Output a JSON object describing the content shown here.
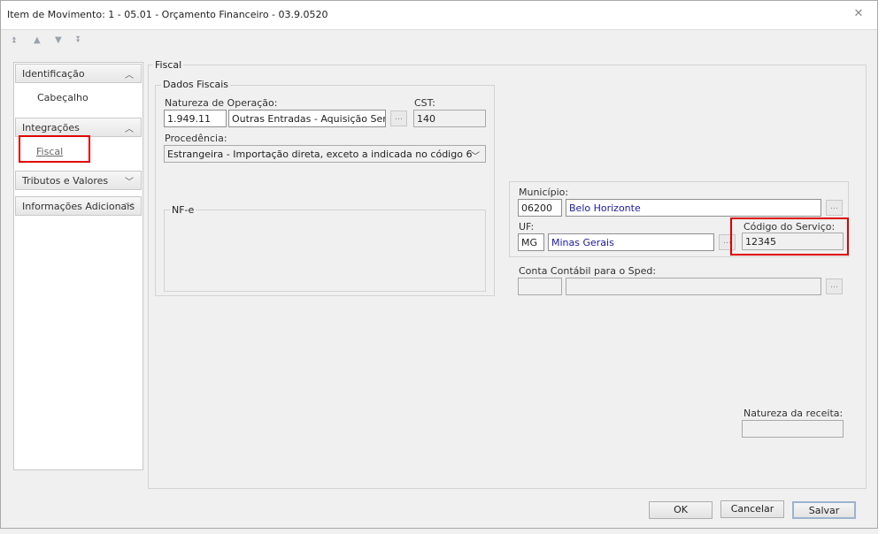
{
  "window": {
    "title": "Item de Movimento: 1 - 05.01 - Orçamento Financeiro - 03.9.0520"
  },
  "sidebar": {
    "sections": [
      {
        "label": "Identificação",
        "expanded": true,
        "items": [
          "Cabeçalho"
        ]
      },
      {
        "label": "Integrações",
        "expanded": true,
        "items": [
          "Fiscal"
        ]
      },
      {
        "label": "Tributos e Valores",
        "expanded": false
      },
      {
        "label": "Informações Adicionais",
        "expanded": false
      }
    ]
  },
  "panel": {
    "title": "Fiscal",
    "dados_fiscais": {
      "title": "Dados Fiscais",
      "natureza_label": "Natureza de Operação:",
      "natureza_code": "1.949.11",
      "natureza_desc": "Outras Entradas - Aquisição Serviços",
      "cst_label": "CST:",
      "cst_value": "140",
      "procedencia_label": "Procedência:",
      "procedencia_value": "Estrangeira - Importação direta, exceto a indicada no código 6",
      "nfe_title": "NF-e"
    },
    "municipio_label": "Município:",
    "municipio_code": "06200",
    "municipio_name": "Belo Horizonte",
    "uf_label": "UF:",
    "uf_code": "MG",
    "uf_name": "Minas Gerais",
    "codigo_servico_label": "Código do Serviço:",
    "codigo_servico_value": "12345",
    "conta_contabil_label": "Conta Contábil para o Sped:",
    "conta_contabil_code": "",
    "conta_contabil_desc": "",
    "natureza_receita_label": "Natureza da receita:",
    "natureza_receita_value": ""
  },
  "buttons": {
    "ok": "OK",
    "cancel": "Cancelar",
    "save": "Salvar"
  },
  "colors": {
    "highlight": "#e00000",
    "link_text": "#1a1aa6"
  }
}
